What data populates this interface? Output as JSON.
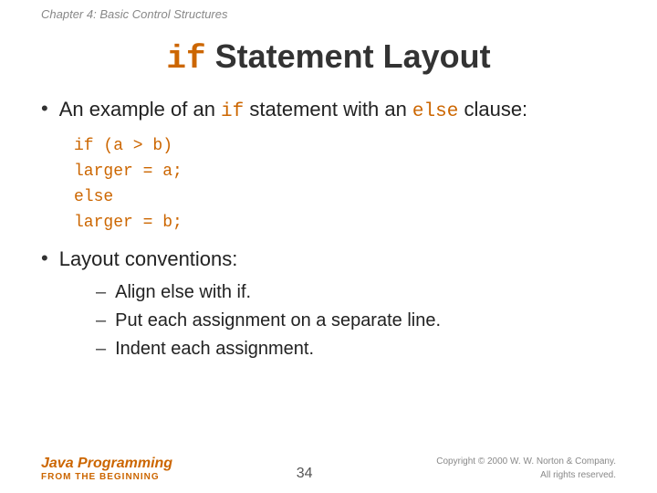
{
  "header": {
    "chapter": "Chapter 4: Basic Control Structures"
  },
  "title": {
    "code_word": "if",
    "rest": " Statement Layout"
  },
  "bullets": [
    {
      "id": "bullet1",
      "text_prefix": "An example of an ",
      "code1": "if",
      "text_middle": " statement with an ",
      "code2": "else",
      "text_suffix": " clause:"
    }
  ],
  "code_block": {
    "line1": "if (a > b)",
    "line2": "  larger = a;",
    "line3": "else",
    "line4": "  larger = b;"
  },
  "bullet2": {
    "text": "Layout conventions:"
  },
  "sub_bullets": [
    {
      "id": "sub1",
      "text_prefix": "Align ",
      "code1": "else",
      "text_middle": " with ",
      "code2": "if",
      "text_suffix": "."
    },
    {
      "id": "sub2",
      "text": "Put each assignment on a separate line."
    },
    {
      "id": "sub3",
      "text": "Indent each assignment."
    }
  ],
  "footer": {
    "title": "Java Programming",
    "subtitle": "FROM THE BEGINNING",
    "page_number": "34",
    "copyright": "Copyright © 2000 W. W. Norton & Company.\nAll rights reserved."
  }
}
